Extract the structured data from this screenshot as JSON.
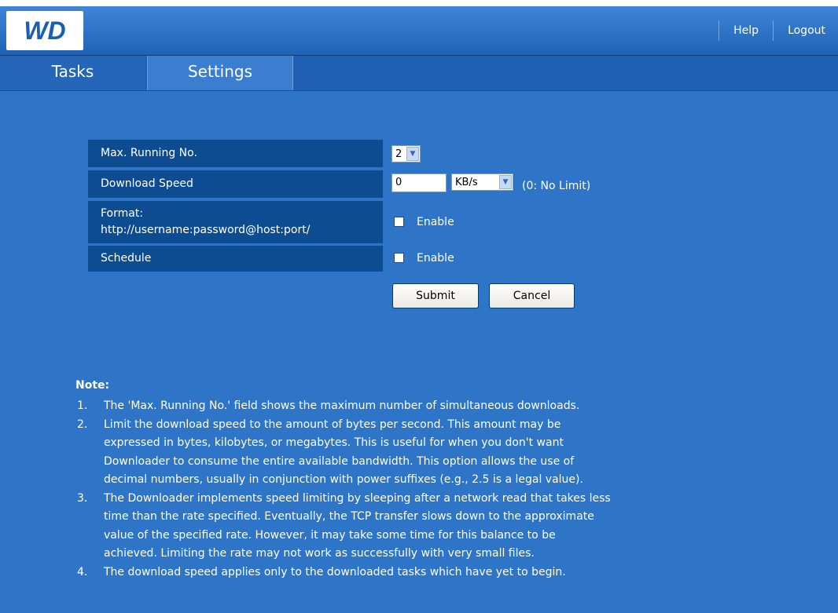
{
  "header": {
    "logo_text": "WD",
    "help_label": "Help",
    "logout_label": "Logout"
  },
  "tabs": [
    {
      "label": "Tasks",
      "active": false
    },
    {
      "label": "Settings",
      "active": true
    }
  ],
  "form": {
    "max_running": {
      "label": "Max. Running No.",
      "value": "2"
    },
    "download_speed": {
      "label": "Download Speed",
      "value": "0",
      "unit": "KB/s",
      "hint": "(0: No Limit)"
    },
    "proxy": {
      "label_line1": "Format:",
      "label_line2": "http://username:password@host:port/",
      "checkbox_label": "Enable",
      "checked": false
    },
    "schedule": {
      "label": "Schedule",
      "checkbox_label": "Enable",
      "checked": false
    },
    "submit_label": "Submit",
    "cancel_label": "Cancel"
  },
  "notes": {
    "title": "Note:",
    "items": [
      {
        "num": "1.",
        "lines": [
          "The 'Max. Running No.' field shows the maximum number of simultaneous downloads."
        ]
      },
      {
        "num": "2.",
        "lines": [
          "Limit the download speed to the amount of bytes per second. This amount may be",
          "expressed in bytes, kilobytes, or megabytes. This is useful for when you don't want",
          "Downloader to consume the entire available bandwidth. This option allows the use of",
          "decimal numbers, usually in conjunction with power suffixes (e.g., 2.5 is a legal value)."
        ]
      },
      {
        "num": "3.",
        "lines": [
          "The Downloader implements speed limiting by sleeping after a network read that takes less",
          "time than the rate specified. Eventually, the TCP transfer slows down to the approximate",
          "value of the specified rate. However, it may take some time for this balance to be",
          "achieved. Limiting the rate may not work as successfully with very small files."
        ]
      },
      {
        "num": "4.",
        "lines": [
          "The download speed applies only to the downloaded tasks which have yet to begin."
        ]
      }
    ]
  },
  "colors": {
    "background": "#2e74c7",
    "label_bg": "#0e4c91",
    "header_bg": "#1f63b6"
  }
}
